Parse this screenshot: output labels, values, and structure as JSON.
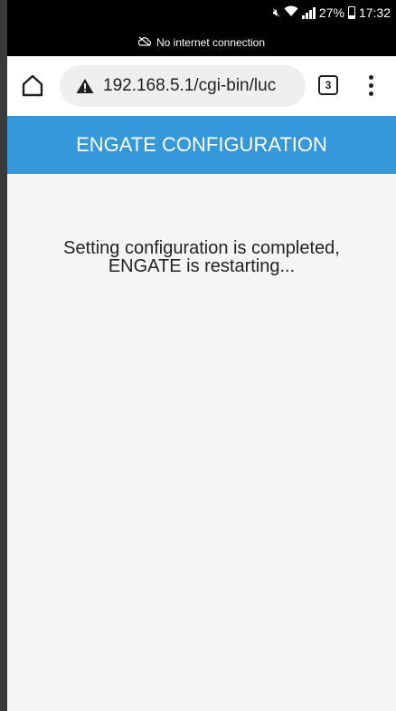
{
  "status_bar": {
    "battery": "27%",
    "time": "17:32",
    "network_notice": "No internet connection"
  },
  "browser": {
    "url": "192.168.5.1/cgi-bin/luc",
    "tab_count": "3"
  },
  "page": {
    "header_title": "ENGATE CONFIGURATION",
    "message_line1": "Setting configuration is completed,",
    "message_line2": "ENGATE is restarting..."
  },
  "colors": {
    "header_bg": "#3498db",
    "status_bar_bg": "#000000",
    "page_bg": "#f5f5f5"
  },
  "icons": [
    "mute-icon",
    "wifi-icon",
    "signal-icon",
    "battery-icon",
    "cloud-off-icon",
    "home-icon",
    "warning-icon",
    "tabs-icon",
    "more-vert-icon"
  ]
}
